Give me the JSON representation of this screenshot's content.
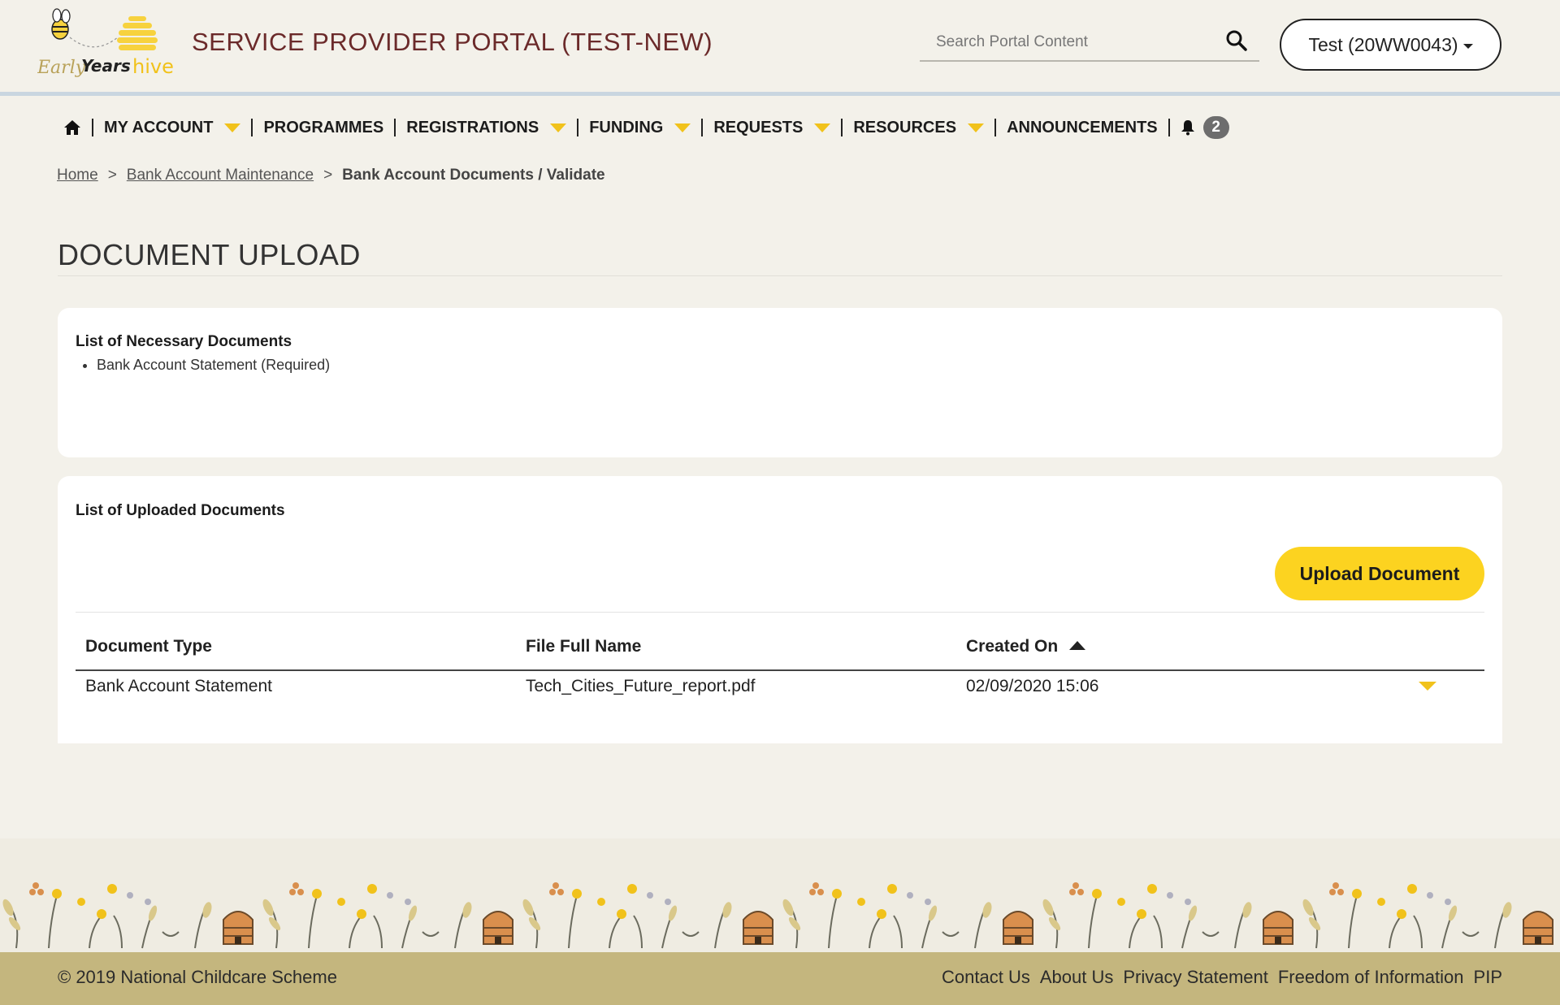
{
  "header": {
    "logo_text": "Early Years hive",
    "portal_title": "SERVICE PROVIDER PORTAL (TEST-NEW)",
    "search_placeholder": "Search Portal Content",
    "account_label": "Test (20WW0043)"
  },
  "nav": {
    "items": [
      {
        "label": "MY ACCOUNT",
        "has_dropdown": true
      },
      {
        "label": "PROGRAMMES",
        "has_dropdown": false
      },
      {
        "label": "REGISTRATIONS",
        "has_dropdown": true
      },
      {
        "label": "FUNDING",
        "has_dropdown": true
      },
      {
        "label": "REQUESTS",
        "has_dropdown": true
      },
      {
        "label": "RESOURCES",
        "has_dropdown": true
      },
      {
        "label": "ANNOUNCEMENTS",
        "has_dropdown": false
      }
    ],
    "notification_count": "2"
  },
  "breadcrumb": {
    "home": "Home",
    "parent": "Bank Account Maintenance",
    "current": "Bank Account Documents / Validate"
  },
  "page": {
    "title": "DOCUMENT UPLOAD"
  },
  "necessary_documents": {
    "heading": "List of Necessary Documents",
    "items": [
      "Bank Account Statement (Required)"
    ]
  },
  "uploaded_documents": {
    "heading": "List of Uploaded Documents",
    "upload_button": "Upload Document",
    "columns": [
      "Document Type",
      "File Full Name",
      "Created On"
    ],
    "rows": [
      {
        "document_type": "Bank Account Statement",
        "file_name": "Tech_Cities_Future_report.pdf",
        "created_on": "02/09/2020 15:06"
      }
    ]
  },
  "footer": {
    "copyright": "© 2019 National Childcare Scheme",
    "links": [
      "Contact Us",
      "About Us",
      "Privacy Statement",
      "Freedom of Information",
      "PIP"
    ]
  },
  "colors": {
    "accent_yellow": "#fcd320",
    "title_maroon": "#6b2a2a",
    "footer_bar": "#c4b67e",
    "background": "#f3f1ea"
  }
}
